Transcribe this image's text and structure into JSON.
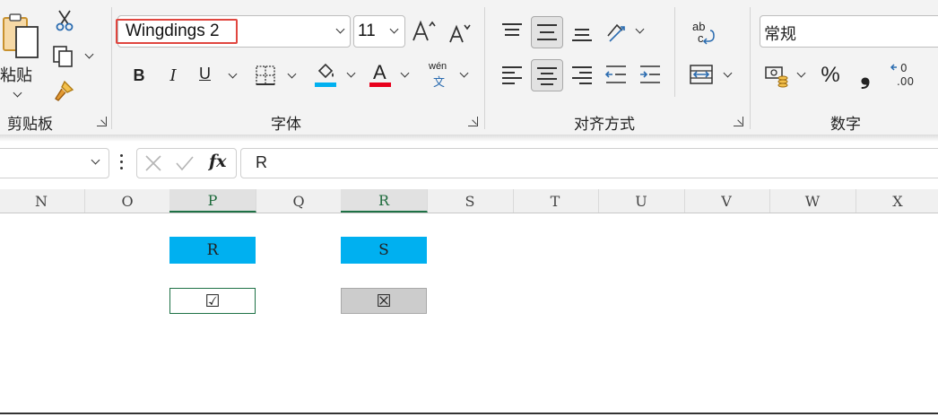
{
  "clipboard": {
    "paste_label": "粘贴",
    "group_label": "剪贴板"
  },
  "font": {
    "font_name": "Wingdings 2",
    "font_size": "11",
    "bold": "B",
    "italic": "I",
    "underline": "U",
    "font_color_glyph": "A",
    "phonetic_top": "wén",
    "phonetic_bottom": "文",
    "group_label": "字体",
    "fill_color": "#00b0f0",
    "font_color": "#e8001c",
    "highlight_box_color": "#e0463f"
  },
  "alignment": {
    "wrap_top": "ab",
    "wrap_bottom": "c",
    "group_label": "对齐方式"
  },
  "number": {
    "format": "常规",
    "percent": "%",
    "comma": "❟",
    "group_label": "数字"
  },
  "formula_bar": {
    "fx": "fx",
    "value": "R"
  },
  "columns": [
    "N",
    "O",
    "P",
    "Q",
    "R",
    "S",
    "T",
    "U",
    "V",
    "W",
    "X"
  ],
  "selected_columns": [
    "P",
    "R"
  ],
  "cells": {
    "p_header": "R",
    "r_header": "S",
    "p_symbol": "☑",
    "r_symbol": "☒",
    "header_fill": "#00b0f0",
    "r_symbol_fill": "#cccccc"
  }
}
